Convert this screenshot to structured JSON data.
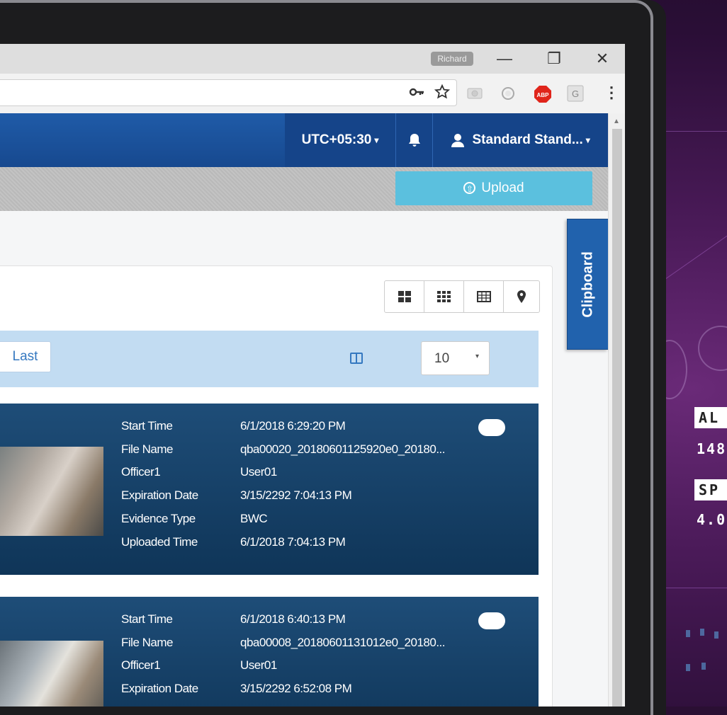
{
  "browser": {
    "profile_name": "Richard",
    "window_controls": {
      "minimize": "—",
      "restore": "❐",
      "close": "✕"
    },
    "toolbar_icons": [
      "key-icon",
      "star-icon",
      "camera-icon",
      "circle-extension-icon",
      "adblock-icon",
      "google-extension-icon",
      "more-vert-icon"
    ],
    "adblock_label": "ABP",
    "g_label": "G",
    "more_label": "⋮"
  },
  "header": {
    "timezone": "UTC+05:30",
    "bell_label": "🔔",
    "user_label": "Standard Stand...",
    "user_icon": "👤"
  },
  "toolbar": {
    "upload_label": "Upload",
    "upload_icon": "⇧"
  },
  "view_modes": [
    "large-grid-icon",
    "small-grid-icon",
    "table-view-icon",
    "map-pin-icon"
  ],
  "pager": {
    "last_label": "Last",
    "page_size": "10",
    "page_size_caret": "▾"
  },
  "clipboard_label": "Clipboard",
  "records": [
    {
      "fields": [
        {
          "label": "Start Time",
          "value": "6/1/2018 6:29:20 PM"
        },
        {
          "label": "File Name",
          "value": "qba00020_20180601125920e0_20180..."
        },
        {
          "label": "Officer1",
          "value": "User01"
        },
        {
          "label": "Expiration Date",
          "value": "3/15/2292 7:04:13 PM"
        },
        {
          "label": "Evidence Type",
          "value": "BWC"
        },
        {
          "label": "Uploaded Time",
          "value": "6/1/2018 7:04:13 PM"
        }
      ]
    },
    {
      "fields": [
        {
          "label": "Start Time",
          "value": "6/1/2018 6:40:13 PM"
        },
        {
          "label": "File Name",
          "value": "qba00008_20180601131012e0_20180..."
        },
        {
          "label": "Officer1",
          "value": "User01"
        },
        {
          "label": "Expiration Date",
          "value": "3/15/2292 6:52:08 PM"
        }
      ]
    }
  ],
  "hud": {
    "label1": "AL",
    "value1": "148",
    "label2": "SP",
    "value2": "4.0"
  },
  "colors": {
    "header_blue": "#1f5ba8",
    "upload_cyan": "#5bc0de",
    "card_navy": "#0f3558",
    "pager_light_blue": "#c2dcf2"
  }
}
